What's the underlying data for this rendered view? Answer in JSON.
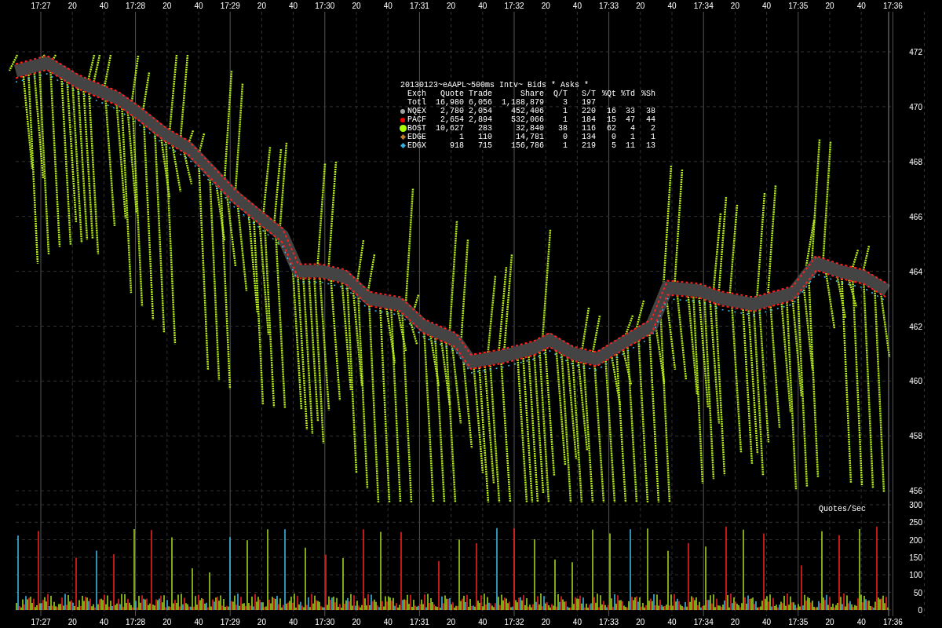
{
  "top_axis": {
    "labels": [
      "17:27",
      "20",
      "40",
      "17:28",
      "20",
      "40",
      "17:29",
      "20",
      "40",
      "17:30",
      "20",
      "40",
      "17:31",
      "20",
      "40",
      "17:32",
      "20",
      "40",
      "17:33",
      "20",
      "40",
      "17:34",
      "20",
      "40",
      "17:35",
      "20",
      "40",
      "17:36"
    ]
  },
  "bottom_axis": {
    "labels": [
      "17:27",
      "20",
      "40",
      "17:28",
      "20",
      "40",
      "17:29",
      "20",
      "40",
      "17:30",
      "20",
      "40",
      "17:31",
      "20",
      "40",
      "17:32",
      "20",
      "40",
      "17:33",
      "20",
      "40",
      "17:34",
      "20",
      "40",
      "17:35",
      "20",
      "40",
      "17:36"
    ]
  },
  "price_axis": {
    "labels": [
      "472",
      "470",
      "468",
      "466",
      "464",
      "462",
      "460",
      "458",
      "456"
    ]
  },
  "volume_axis": {
    "title": "Quotes/Sec",
    "labels": [
      "300",
      "250",
      "200",
      "150",
      "100",
      "50",
      "0"
    ]
  },
  "legend": {
    "title": "20130123~eAAPL~500ms Intv~ Bids * Asks *",
    "columns": [
      "Exch",
      "Quote",
      "Trade",
      "Share",
      "Q/T",
      "S/T",
      "%Qt",
      "%Td",
      "%Sh"
    ],
    "rows": [
      {
        "cells": [
          "Totl",
          "16,980",
          "6,056",
          "1,188,879",
          "3",
          "197"
        ]
      },
      {
        "kind": "dot",
        "color": "#a0a0a0",
        "cells": [
          "NQEX",
          "2,780",
          "2,054",
          "452,406",
          "1",
          "220",
          "16",
          "33",
          "38"
        ]
      },
      {
        "kind": "dot",
        "color": "#ff0000",
        "cells": [
          "PACF",
          "2,654",
          "2,894",
          "532,066",
          "1",
          "184",
          "15",
          "47",
          "44"
        ]
      },
      {
        "kind": "large-dot",
        "color": "#a8ff00",
        "cells": [
          "BOST",
          "10,627",
          "283",
          "32,840",
          "38",
          "116",
          "62",
          "4",
          "2"
        ]
      },
      {
        "kind": "diamond",
        "color": "#c08020",
        "cells": [
          "EDGE",
          "1",
          "110",
          "14,781",
          "0",
          "134",
          "0",
          "1",
          "1"
        ]
      },
      {
        "kind": "diamond",
        "color": "#30b0e0",
        "cells": [
          "EDGX",
          "918",
          "715",
          "156,786",
          "1",
          "219",
          "5",
          "11",
          "13"
        ]
      }
    ]
  }
}
